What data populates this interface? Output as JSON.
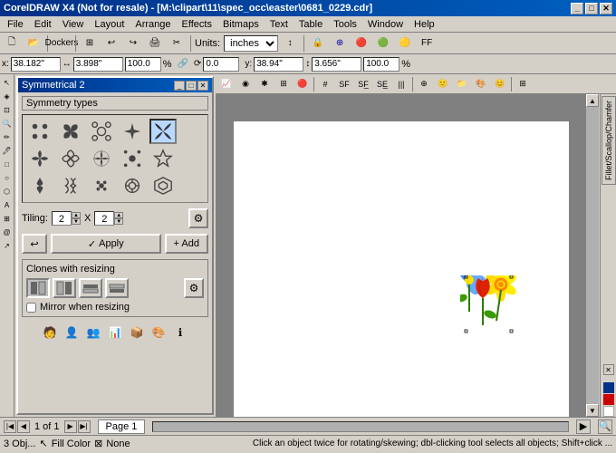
{
  "app": {
    "title": "CorelDRAW X4 (Not for resale) - [M:\\clipart\\11\\spec_occ\\easter\\0681_0229.cdr]",
    "title_short": "CorelDRAW X4 (Not for resale)"
  },
  "menu": {
    "items": [
      "File",
      "Edit",
      "View",
      "Layout",
      "Arrange",
      "Effects",
      "Bitmaps",
      "Text",
      "Table",
      "Tools",
      "Window",
      "Help"
    ]
  },
  "toolbar": {
    "units_label": "Units:",
    "units_value": "inches",
    "lock_icon": "🔒"
  },
  "coords": {
    "x_label": "x:",
    "x_value": "38.182\"",
    "y_label": "y:",
    "y_value": "38.94\"",
    "w_label": "",
    "w_value": "3.898\"",
    "h_value": "3.656\"",
    "pct1": "100.0",
    "pct2": "100.0",
    "pct3": "%",
    "angle": "0.0"
  },
  "symmetrical_panel": {
    "title": "Symmetrical 2",
    "section_label": "Symmetry types",
    "symmetry_cells": [
      "s1",
      "s2",
      "s3",
      "s4",
      "s5",
      "s6",
      "s7",
      "s8",
      "s9",
      "s10",
      "s11",
      "s12",
      "s13",
      "s14",
      "s15"
    ],
    "tiling_label": "Tiling:",
    "tiling_x": "2",
    "tiling_y": "2",
    "x_label": "X",
    "apply_label": "Apply",
    "add_label": "+ Add",
    "clones_label": "Clones with resizing",
    "mirror_label": "Mirror when resizing",
    "bottom_icons": [
      "person1",
      "person2",
      "person3",
      "chart",
      "box",
      "palette",
      "info"
    ]
  },
  "canvas": {
    "objects": "3 Obj...",
    "fill_label": "Fill Color",
    "none_label": "None"
  },
  "page": {
    "current": "1 of 1",
    "name": "Page 1"
  },
  "statusbar": {
    "hint": "Click an object twice for rotating/skewing; dbl-clicking tool selects all objects; Shift+click ..."
  },
  "right_panel": {
    "label": "Fillet/Scallop/Chamfer"
  },
  "colors": {
    "accent_blue": "#003087",
    "toolbar_bg": "#d4d0c8",
    "canvas_bg": "#808080"
  }
}
